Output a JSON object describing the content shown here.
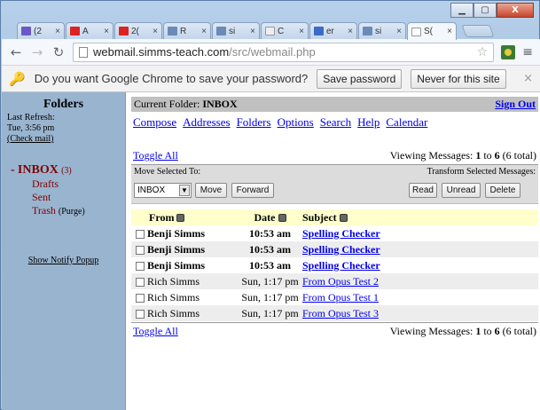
{
  "window": {
    "minimize": "▁",
    "maximize": "▢",
    "close": "X"
  },
  "tabs": [
    {
      "label": "(2",
      "icon_color": "#6a58c7"
    },
    {
      "label": "A",
      "icon_color": "#d22"
    },
    {
      "label": "2(",
      "icon_color": "#d22"
    },
    {
      "label": "R",
      "icon_color": "#6a8bb8"
    },
    {
      "label": "si",
      "icon_color": "#6a8bb8"
    },
    {
      "label": "C",
      "icon_color": "#ddd"
    },
    {
      "label": "er",
      "icon_color": "#3a6bc6"
    },
    {
      "label": "si",
      "icon_color": "#6a8bb8"
    },
    {
      "label": "S(",
      "icon_color": "#ddd"
    }
  ],
  "toolbar": {
    "url_host": "webmail.simms-teach.com",
    "url_path": "/src/webmail.php"
  },
  "infobar": {
    "text": "Do you want Google Chrome to save your password?",
    "save": "Save password",
    "never": "Never for this site",
    "close": "×"
  },
  "sidebar": {
    "title": "Folders",
    "refresh_label": "Last Refresh:",
    "refresh_time": "Tue, 3:56 pm",
    "check_mail": "(Check mail)",
    "inbox_prefix": "-",
    "inbox": "INBOX",
    "inbox_count": "(3)",
    "drafts": "Drafts",
    "sent": "Sent",
    "trash": "Trash",
    "purge": "(Purge)",
    "notify": "Show Notify Popup"
  },
  "header": {
    "label": "Current Folder:",
    "folder": "INBOX",
    "signout": "Sign Out"
  },
  "nav": [
    "Compose",
    "Addresses",
    "Folders",
    "Options",
    "Search",
    "Help",
    "Calendar"
  ],
  "listing": {
    "toggle_all": "Toggle All",
    "viewing_prefix": "Viewing Messages:",
    "from_n": "1",
    "to_word": "to",
    "to_n": "6",
    "total": "(6 total)"
  },
  "actions": {
    "move_label": "Move Selected To:",
    "transform_label": "Transform Selected Messages:",
    "select_value": "INBOX",
    "move": "Move",
    "forward": "Forward",
    "read": "Read",
    "unread": "Unread",
    "delete": "Delete"
  },
  "columns": {
    "from": "From",
    "date": "Date",
    "subject": "Subject"
  },
  "messages": [
    {
      "from": "Benji Simms",
      "date": "10:53 am",
      "subject": "Spelling Checker",
      "unread": true
    },
    {
      "from": "Benji Simms",
      "date": "10:53 am",
      "subject": "Spelling Checker",
      "unread": true
    },
    {
      "from": "Benji Simms",
      "date": "10:53 am",
      "subject": "Spelling Checker",
      "unread": true
    },
    {
      "from": "Rich Simms",
      "date": "Sun, 1:17 pm",
      "subject": "From Opus Test 2",
      "unread": false
    },
    {
      "from": "Rich Simms",
      "date": "Sun, 1:17 pm",
      "subject": "From Opus Test 1",
      "unread": false
    },
    {
      "from": "Rich Simms",
      "date": "Sun, 1:17 pm",
      "subject": "From Opus Test 3",
      "unread": false
    }
  ]
}
